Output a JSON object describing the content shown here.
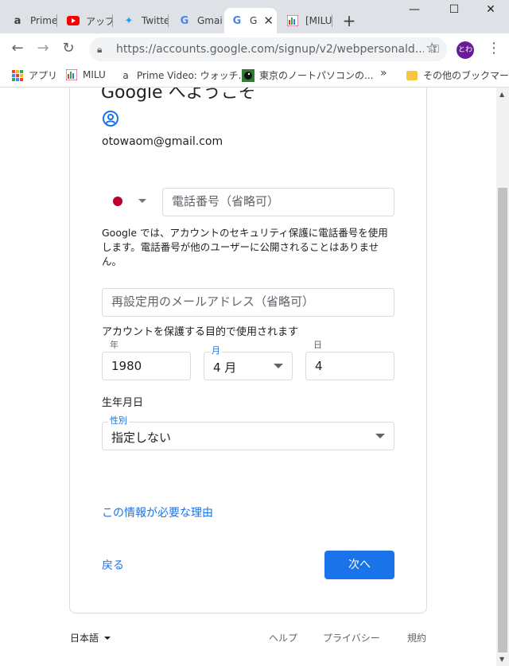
{
  "browser": {
    "tabs": [
      {
        "label": "Prime",
        "icon": "amazon-icon"
      },
      {
        "label": "アップ",
        "icon": "youtube-icon"
      },
      {
        "label": "Twitte",
        "icon": "twitter-icon"
      },
      {
        "label": "Gmai",
        "icon": "google-icon"
      },
      {
        "label": "G",
        "icon": "google-icon",
        "active": true
      },
      {
        "label": "[MILU",
        "icon": "milu-icon"
      }
    ],
    "url": "https://accounts.google.com/signup/v2/webpersonald...",
    "profile_initials": "とわ",
    "bookmarks": [
      {
        "label": "アプリ",
        "icon": "apps-grid-icon"
      },
      {
        "label": "MILU",
        "icon": "milu-icon"
      },
      {
        "label": "Prime Video: ウォッチ...",
        "icon": "amazon-icon"
      },
      {
        "label": "東京のノートパソコンの...",
        "icon": "bird-icon"
      }
    ],
    "bookmarks_overflow": "»",
    "other_bookmarks": "その他のブックマーク"
  },
  "page": {
    "heading": "Google へようこそ",
    "email": "otowaom@gmail.com",
    "phone_placeholder": "電話番号（省略可）",
    "phone_note": "Google では、アカウントのセキュリティ保護に電話番号を使用します。電話番号が他のユーザーに公開されることはありません。",
    "recovery_email_placeholder": "再設定用のメールアドレス（省略可）",
    "recovery_note": "アカウントを保護する目的で使用されます",
    "birth": {
      "year_label": "年",
      "year_value": "1980",
      "month_label": "月",
      "month_value": "4 月",
      "day_label": "日",
      "day_value": "4"
    },
    "birthday_caption": "生年月日",
    "gender_label": "性別",
    "gender_value": "指定しない",
    "why_link": "この情報が必要な理由",
    "back_label": "戻る",
    "next_label": "次へ"
  },
  "footer": {
    "language": "日本語",
    "help": "ヘルプ",
    "privacy": "プライバシー",
    "terms": "規約"
  },
  "colors": {
    "accent": "#1a73e8",
    "flag_red": "#bc002d",
    "avatar": "#6a1b9a"
  }
}
